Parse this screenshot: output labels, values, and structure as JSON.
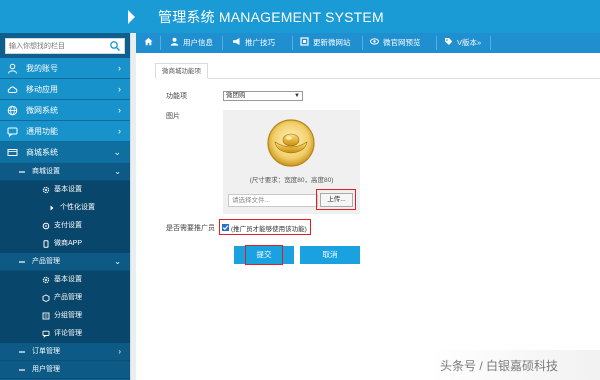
{
  "header": {
    "title": "管理系统 MANAGEMENT SYSTEM"
  },
  "sidebar": {
    "search_placeholder": "输入你想找的栏目",
    "items": [
      {
        "label": "我的账号",
        "icon": "user-icon",
        "arrow": "›"
      },
      {
        "label": "移动应用",
        "icon": "cloud-icon",
        "arrow": "›"
      },
      {
        "label": "微网系统",
        "icon": "globe-icon",
        "arrow": "›"
      },
      {
        "label": "通用功能",
        "icon": "chat-icon",
        "arrow": "›"
      },
      {
        "label": "商城系统",
        "icon": "cart-icon",
        "arrow": "⌄"
      }
    ],
    "mall_settings": {
      "label": "商城设置",
      "arrow": "⌄"
    },
    "mall_settings_children": [
      {
        "label": "基本设置",
        "icon": "gear-icon"
      },
      {
        "label": "个性化设置",
        "icon": "caret-right-icon"
      },
      {
        "label": "支付设置",
        "icon": "settings-icon"
      },
      {
        "label": "微商APP",
        "icon": "phone-icon"
      }
    ],
    "product_manage": {
      "label": "产品管理",
      "arrow": "⌄"
    },
    "product_children": [
      {
        "label": "基本设置",
        "icon": "gear-icon"
      },
      {
        "label": "产品管理",
        "icon": "box-icon"
      },
      {
        "label": "分组管理",
        "icon": "list-icon"
      },
      {
        "label": "评论管理",
        "icon": "comment-icon"
      }
    ],
    "order_manage": {
      "label": "订单管理",
      "arrow": "›"
    },
    "user_manage": {
      "label": "用户管理"
    }
  },
  "toolbar": {
    "items": [
      {
        "label": "",
        "icon": "home-icon"
      },
      {
        "label": "用户信息",
        "icon": "user-icon"
      },
      {
        "label": "推广技巧",
        "icon": "megaphone-icon"
      },
      {
        "label": "更新微网站",
        "icon": "refresh-icon"
      },
      {
        "label": "微官网预览",
        "icon": "eye-icon"
      },
      {
        "label": "V版本»",
        "icon": "tag-icon"
      }
    ]
  },
  "content": {
    "tab": "微商城功能项",
    "function_label": "功能项",
    "function_value": "微团购",
    "image_label": "图片",
    "image_hint": "(尺寸要求：宽度80，高度80)",
    "file_placeholder": "请选择文件...",
    "upload_label": "上传...",
    "promoter_label": "是否需要推广员",
    "promoter_checkbox_label": "(推广员才能够使用该功能)",
    "promoter_checked": true,
    "submit_label": "提交",
    "cancel_label": "取消"
  },
  "watermark": "头条号 / 白银嘉硕科技",
  "colors": {
    "header": "#1a9bd6",
    "sidebar_item": "#1792ca",
    "sidebar_dark": "#08466b",
    "button": "#1aa2e0",
    "highlight": "#e02020"
  }
}
